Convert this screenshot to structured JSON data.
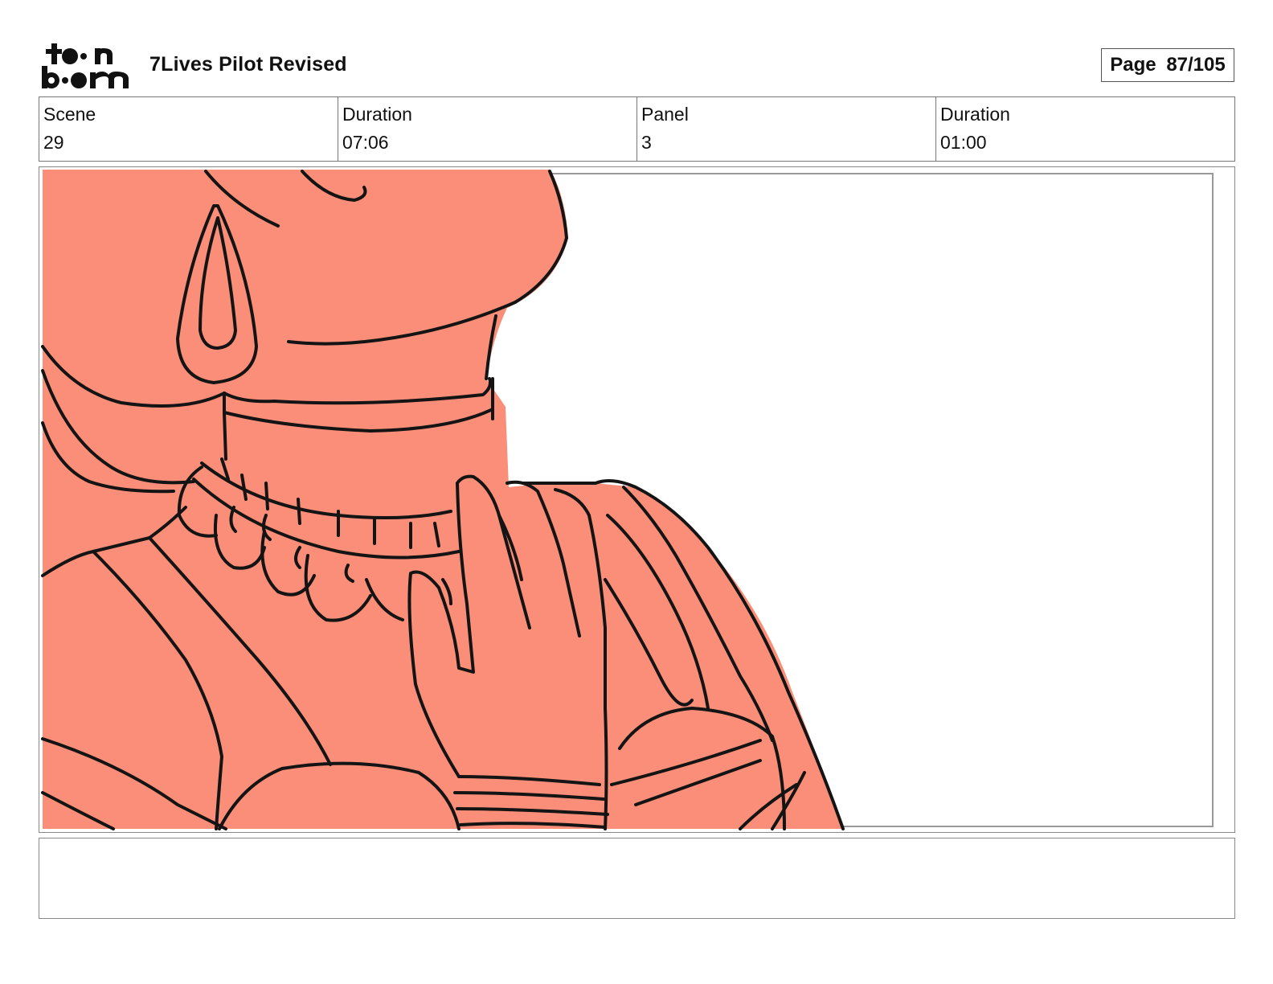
{
  "header": {
    "logo": {
      "text": "toon boom",
      "icon": "toon-boom-logo"
    },
    "title": "7Lives Pilot Revised",
    "page": {
      "label": "Page",
      "value": "87/105"
    }
  },
  "info": {
    "scene_label": "Scene",
    "scene_value": "29",
    "scene_duration_label": "Duration",
    "scene_duration_value": "07:06",
    "panel_label": "Panel",
    "panel_value": "3",
    "panel_duration_label": "Duration",
    "panel_duration_value": "01:00"
  },
  "panel": {
    "image": "storyboard-sketch-neck-necklace-hand",
    "fill_color": "#fa8e78",
    "line_color": "#141414"
  },
  "notes": {
    "text": ""
  }
}
